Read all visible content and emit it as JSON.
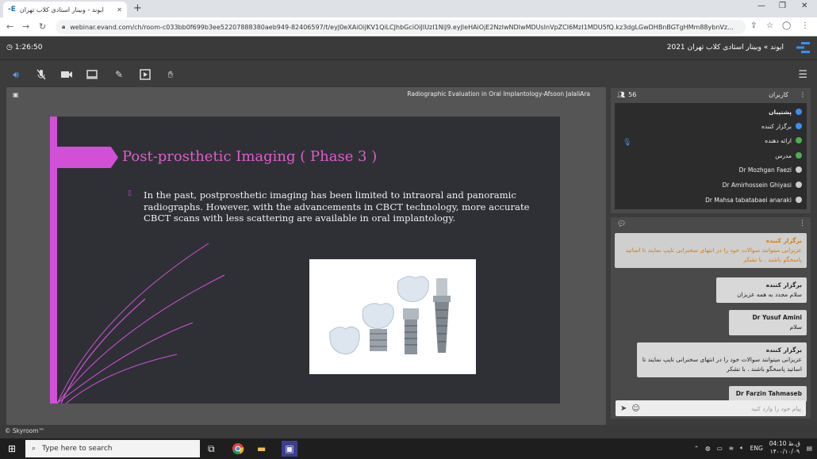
{
  "browser": {
    "tab_title": "ایوند - وبینار استادی کلاب تهران",
    "url": "webinar.evand.com/ch/room-c033bb0f699b3ee52207888380aeb949-82406597/t/eyJ0eXAiOiJKV1QiLCJhbGciOiJIUzI1NiJ9.eyJleHAiOjE2NzIwNDIwMDUsInVpZCI6MzI1MDU5fQ.kz3dgLGwDHBnBGTgHMm88ybnVz..."
  },
  "header": {
    "timer": "1:26:50",
    "room_title": "ایوند » وبینار استادی کلاب تهران 2021"
  },
  "stage": {
    "title": "Radiographic Evaluation in Oral Implantology-Afsoon JalaliAra",
    "slide_heading": "Post-prosthetic Imaging ( Phase 3 )",
    "slide_body": "In the past, postprosthetic imaging has been limited to intraoral and panoramic radiographs. However, with the advancements in CBCT technology, more accurate CBCT scans with less scattering are available in oral implantology."
  },
  "users": {
    "heading": "کاربران",
    "count": "56",
    "list": [
      {
        "name": "پشتیبان",
        "color": "#3d8ef0"
      },
      {
        "name": "برگزار کننده",
        "color": "#3d8ef0"
      },
      {
        "name": "ارائه دهنده",
        "color": "#4caf50"
      },
      {
        "name": "مدرس",
        "color": "#4caf50"
      },
      {
        "name": "Dr Mozhgan Faezi",
        "color": "#cccccc"
      },
      {
        "name": "Dr Amirhossein Ghiyasi",
        "color": "#cccccc"
      },
      {
        "name": "Dr Mahsa tabatabaei anaraki",
        "color": "#cccccc"
      }
    ]
  },
  "chat": {
    "messages": [
      {
        "sender": "برگزار کننده",
        "text": "عزیزانی میتوانند سوالات خود را در انتهای سخنرانی تایپ نمایند تا اساتید پاسخگو باشند . با تشکر"
      },
      {
        "sender": "برگزار کننده",
        "text": "سلام مجدد به همه عزیزان"
      },
      {
        "sender": "Dr Yusuf Amini",
        "text": "سلام"
      },
      {
        "sender": "برگزار کننده",
        "text": "عزیزانی میتوانند سوالات خود را در انتهای سخنرانی تایپ نمایند تا اساتید پاسخگو باشند . با تشکر"
      },
      {
        "sender": "Dr Farzin Tahmaseb",
        "text": ""
      }
    ],
    "input_placeholder": "پیام خود را وارد کنید"
  },
  "footer": {
    "brand": "© Skyroom™"
  },
  "taskbar": {
    "search_placeholder": "Type here to search",
    "lang": "ENG",
    "time": "04:10 ق.ظ",
    "date": "۱۴۰۰/۱۰/۰۹"
  }
}
